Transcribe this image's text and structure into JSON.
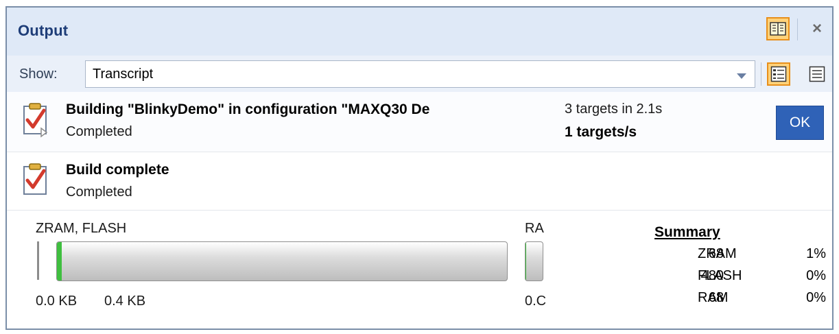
{
  "window": {
    "title": "Output"
  },
  "toolbar": {
    "show_label": "Show:",
    "show_value": "Transcript"
  },
  "tasks": [
    {
      "title": "Building \"BlinkyDemo\" in configuration \"MAXQ30 De",
      "status": "Completed",
      "stat1": "3 targets in 2.1s",
      "stat2": "1 targets/s",
      "button": "OK"
    },
    {
      "title": "Build complete",
      "status": "Completed"
    }
  ],
  "memory": {
    "chart1_label": "ZRAM, FLASH",
    "chart1_ticks": [
      "0.0 KB",
      "0.4 KB"
    ],
    "chart2_label": "RA",
    "chart2_tick": "0.C",
    "bar_fill_percent": 1,
    "summary_title": "Summary",
    "summary": [
      {
        "value": "68",
        "name": "ZRAM",
        "pct": "1%"
      },
      {
        "value": "480",
        "name": "FLASH",
        "pct": "0%"
      },
      {
        "value": "68",
        "name": "RAM",
        "pct": "0%"
      }
    ]
  },
  "icons": {
    "help": "help-book-icon",
    "close": "close-icon",
    "details_view": "details-view-icon",
    "list_view": "list-view-icon",
    "task": "clipboard-check-icon"
  },
  "colors": {
    "title": "#1e3d78",
    "ok_button": "#2f62b7",
    "highlight": "#ffd27a",
    "bar_fill": "#3fbf3f"
  }
}
